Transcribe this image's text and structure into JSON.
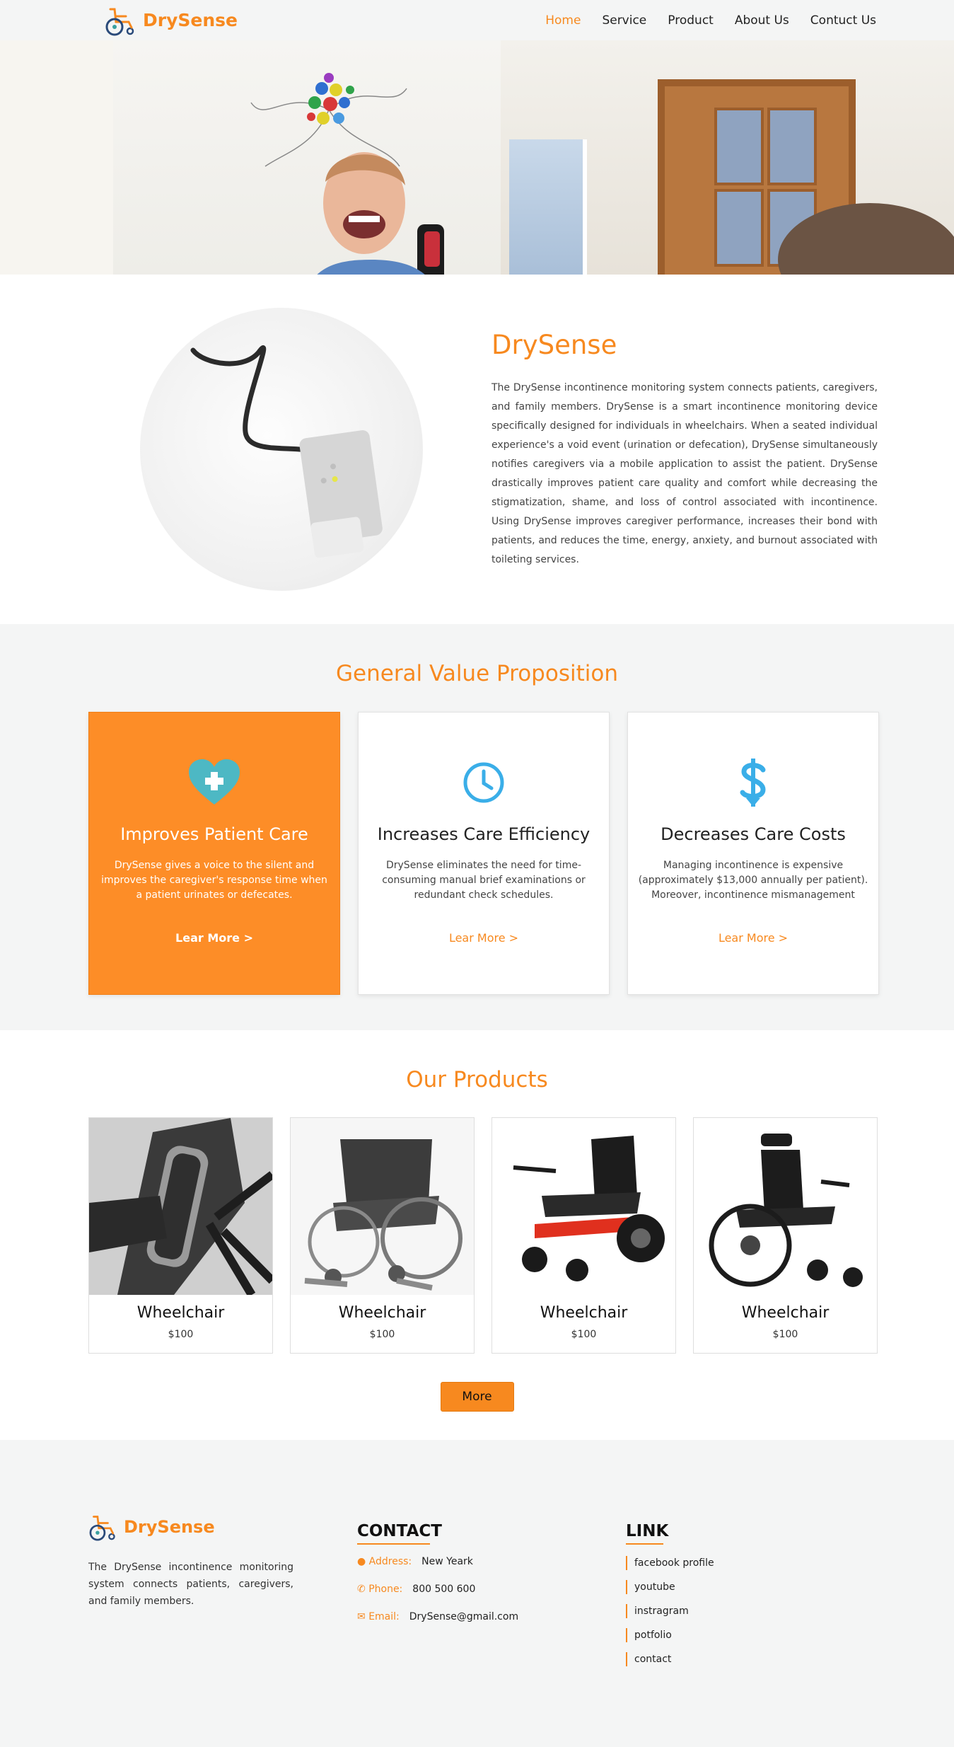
{
  "brand": {
    "name": "DrySense"
  },
  "nav": {
    "items": [
      {
        "label": "Home",
        "active": true
      },
      {
        "label": "Service"
      },
      {
        "label": "Product"
      },
      {
        "label": "About Us"
      },
      {
        "label": "Contuct Us"
      }
    ]
  },
  "about": {
    "title": "DrySense",
    "description": "The DrySense incontinence monitoring system connects patients, caregivers, and family members. DrySense is a smart incontinence monitoring device specifically designed for individuals in wheelchairs. When a seated individual experience's a void event (urination or defecation), DrySense simultaneously notifies caregivers via a mobile application to assist the patient. DrySense drastically improves patient care quality and comfort while decreasing the stigmatization, shame, and loss of control associated with incontinence. Using DrySense improves caregiver performance, increases their bond with patients, and reduces the time, energy, anxiety, and burnout associated with toileting services."
  },
  "value": {
    "title": "General Value Proposition",
    "cards": [
      {
        "icon": "heart-plus-icon",
        "title": "Improves Patient Care",
        "description": "DrySense gives a voice to the silent and improves the caregiver's response time when a patient urinates or defecates.",
        "link": "Lear More >"
      },
      {
        "icon": "clock-icon",
        "title": "Increases Care Efficiency",
        "description": "DrySense eliminates the need for time-consuming manual brief examinations or redundant check schedules.",
        "link": "Lear More >"
      },
      {
        "icon": "dollar-icon",
        "title": "Decreases Care Costs",
        "description": "Managing incontinence is expensive (approximately $13,000 annually per patient). Moreover, incontinence mismanagement",
        "link": "Lear More >"
      }
    ]
  },
  "products": {
    "title": "Our Products",
    "items": [
      {
        "name": "Wheelchair",
        "price": "$100"
      },
      {
        "name": "Wheelchair",
        "price": "$100"
      },
      {
        "name": "Wheelchair",
        "price": "$100"
      },
      {
        "name": "Wheelchair",
        "price": "$100"
      }
    ],
    "more_label": "More"
  },
  "footer": {
    "brand": "DrySense",
    "about": "The DrySense incontinence monitoring system connects patients, caregivers, and family members.",
    "contact": {
      "heading": "CONTACT",
      "address_label": "Address:",
      "address": "New Yeark",
      "phone_label": "Phone:",
      "phone": "800 500 600",
      "email_label": "Email:",
      "email": "DrySense@gmail.com"
    },
    "links": {
      "heading": "LINK",
      "items": [
        "facebook profile",
        "youtube",
        "instragram",
        "potfolio",
        "contact"
      ]
    }
  },
  "colors": {
    "accent": "#f7891f",
    "card_highlight": "#fd8d27",
    "icon_teal": "#4db8c4",
    "icon_blue": "#3aaee8",
    "section_bg": "#f4f5f5"
  }
}
